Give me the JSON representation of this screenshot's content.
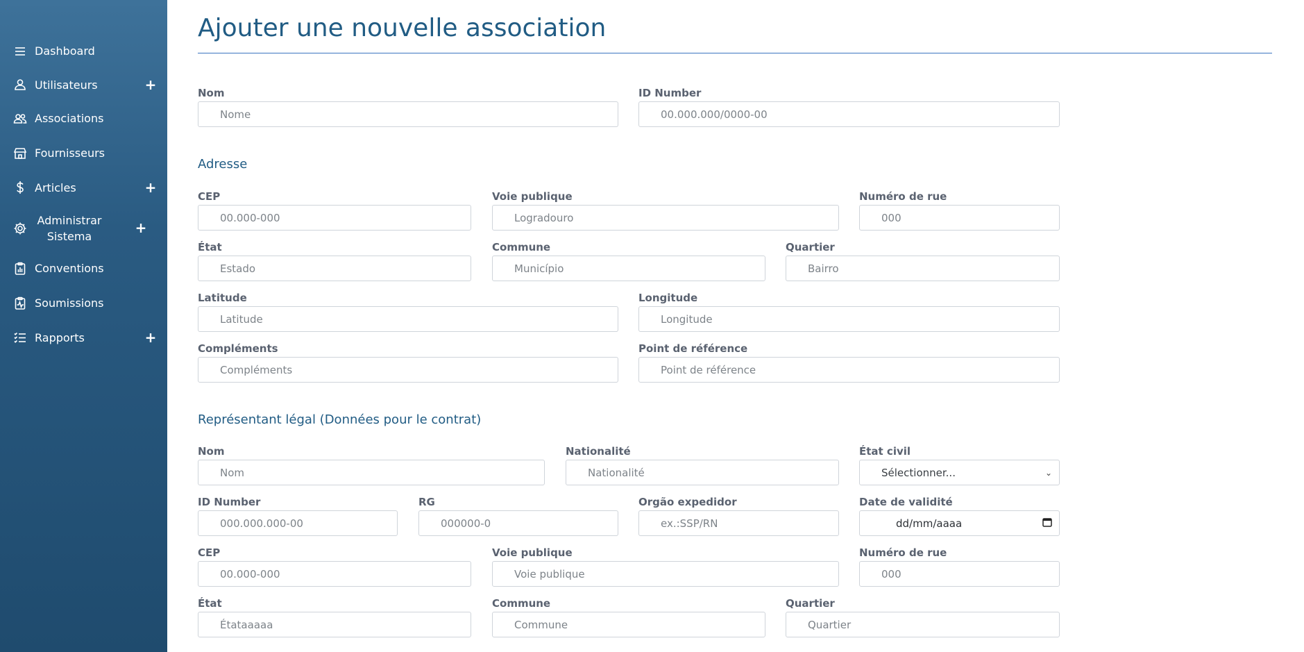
{
  "sidebar": {
    "items": [
      {
        "label": "Dashboard",
        "icon": "menu-icon",
        "expandable": false
      },
      {
        "label": "Utilisateurs",
        "icon": "user-icon",
        "expandable": true
      },
      {
        "label": "Associations",
        "icon": "users-icon",
        "expandable": false
      },
      {
        "label": "Fournisseurs",
        "icon": "store-icon",
        "expandable": false
      },
      {
        "label": "Articles",
        "icon": "dollar-icon",
        "expandable": true
      },
      {
        "label": "Administrar Sistema",
        "icon": "gear-icon",
        "expandable": true
      },
      {
        "label": "Conventions",
        "icon": "clipboard-chart-icon",
        "expandable": false
      },
      {
        "label": "Soumissions",
        "icon": "clipboard-pulse-icon",
        "expandable": false
      },
      {
        "label": "Rapports",
        "icon": "list-check-icon",
        "expandable": true
      }
    ],
    "plus_symbol": "+"
  },
  "page": {
    "title": "Ajouter une nouvelle association"
  },
  "association": {
    "nom": {
      "label": "Nom",
      "placeholder": "Nome"
    },
    "id_number": {
      "label": "ID Number",
      "placeholder": "00.000.000/0000-00"
    }
  },
  "address": {
    "heading": "Adresse",
    "cep": {
      "label": "CEP",
      "placeholder": "00.000-000"
    },
    "voie": {
      "label": "Voie publique",
      "placeholder": "Logradouro"
    },
    "numero": {
      "label": "Numéro de rue",
      "placeholder": "000"
    },
    "etat": {
      "label": "État",
      "placeholder": "Estado"
    },
    "commune": {
      "label": "Commune",
      "placeholder": "Município"
    },
    "quartier": {
      "label": "Quartier",
      "placeholder": "Bairro"
    },
    "latitude": {
      "label": "Latitude",
      "placeholder": "Latitude"
    },
    "longitude": {
      "label": "Longitude",
      "placeholder": "Longitude"
    },
    "complements": {
      "label": "Compléments",
      "placeholder": "Compléments"
    },
    "reference": {
      "label": "Point de référence",
      "placeholder": "Point de référence"
    }
  },
  "representative": {
    "heading": "Représentant légal (Données pour le contrat)",
    "nom": {
      "label": "Nom",
      "placeholder": "Nom"
    },
    "nationalite": {
      "label": "Nationalité",
      "placeholder": "Nationalité"
    },
    "etat_civil": {
      "label": "État civil",
      "value": "Sélectionner..."
    },
    "id_number": {
      "label": "ID Number",
      "placeholder": "000.000.000-00"
    },
    "rg": {
      "label": "RG",
      "placeholder": "000000-0"
    },
    "orgao": {
      "label": "Orgão expedidor",
      "placeholder": "ex.:SSP/RN"
    },
    "validite": {
      "label": "Date de validité",
      "value": "dd/mm/aaaa"
    },
    "cep": {
      "label": "CEP",
      "placeholder": "00.000-000"
    },
    "voie": {
      "label": "Voie publique",
      "placeholder": "Voie publique"
    },
    "numero": {
      "label": "Numéro de rue",
      "placeholder": "000"
    },
    "etat": {
      "label": "État",
      "placeholder": "Étataaaaa"
    },
    "commune": {
      "label": "Commune",
      "placeholder": "Commune"
    },
    "quartier": {
      "label": "Quartier",
      "placeholder": "Quartier"
    }
  },
  "colors": {
    "sidebar_top": "#3e729a",
    "sidebar_bottom": "#1f4b6e",
    "title": "#215c84",
    "rule": "#3a74c0"
  }
}
